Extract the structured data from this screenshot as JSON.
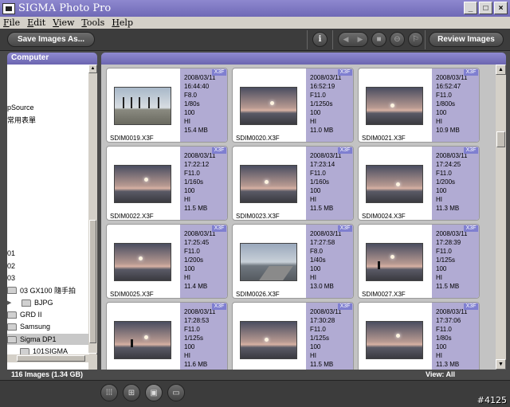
{
  "window": {
    "title": "SIGMA Photo Pro",
    "minimize": "_",
    "maximize": "□",
    "close": "×"
  },
  "menu": [
    "File",
    "Edit",
    "View",
    "Tools",
    "Help"
  ],
  "toolbar": {
    "save_label": "Save Images As...",
    "review_label": "Review Images",
    "info_label": "i"
  },
  "left_panel": {
    "header": "Computer",
    "tree_items": [
      {
        "label": "pSource",
        "type": "text"
      },
      {
        "label": "常用表單",
        "type": "text"
      },
      {
        "label": "01",
        "type": "text"
      },
      {
        "label": "02",
        "type": "text"
      },
      {
        "label": "03",
        "type": "text"
      },
      {
        "label": "03 GX100 隨手拍",
        "type": "folder"
      },
      {
        "label": "BJPG",
        "type": "folder-child"
      },
      {
        "label": "GRD II",
        "type": "folder"
      },
      {
        "label": "Samsung",
        "type": "folder"
      },
      {
        "label": "Sigma DP1",
        "type": "folder"
      },
      {
        "label": "101SIGMA",
        "type": "folder-child"
      }
    ],
    "image_count": "116 Images   (1.34 GB)"
  },
  "right_panel": {
    "view_label": "View: All"
  },
  "badge_label": "X3F",
  "images": [
    {
      "file": "SDIM0019.X3F",
      "date": "2008/03/11",
      "time": "16:44:40",
      "aperture": "F8.0",
      "shutter": "1/80s",
      "iso": "100",
      "quality": "HI",
      "size": "15.4 MB",
      "scene": "palms"
    },
    {
      "file": "SDIM0020.X3F",
      "date": "2008/03/11",
      "time": "16:52:19",
      "aperture": "F11.0",
      "shutter": "1/1250s",
      "iso": "100",
      "quality": "HI",
      "size": "11.0 MB",
      "scene": "sunset"
    },
    {
      "file": "SDIM0021.X3F",
      "date": "2008/03/11",
      "time": "16:52:47",
      "aperture": "F11.0",
      "shutter": "1/800s",
      "iso": "100",
      "quality": "HI",
      "size": "10.9 MB",
      "scene": "sunset"
    },
    {
      "file": "SDIM0022.X3F",
      "date": "2008/03/11",
      "time": "17:22:12",
      "aperture": "F11.0",
      "shutter": "1/160s",
      "iso": "100",
      "quality": "HI",
      "size": "11.5 MB",
      "scene": "sunset"
    },
    {
      "file": "SDIM0023.X3F",
      "date": "2008/03/11",
      "time": "17:23:14",
      "aperture": "F11.0",
      "shutter": "1/160s",
      "iso": "100",
      "quality": "HI",
      "size": "11.5 MB",
      "scene": "sunset"
    },
    {
      "file": "SDIM0024.X3F",
      "date": "2008/03/11",
      "time": "17:24:25",
      "aperture": "F11.0",
      "shutter": "1/200s",
      "iso": "100",
      "quality": "HI",
      "size": "11.3 MB",
      "scene": "sunset"
    },
    {
      "file": "SDIM0025.X3F",
      "date": "2008/03/11",
      "time": "17:25:45",
      "aperture": "F11.0",
      "shutter": "1/200s",
      "iso": "100",
      "quality": "HI",
      "size": "11.4 MB",
      "scene": "sunset"
    },
    {
      "file": "SDIM0026.X3F",
      "date": "2008/03/11",
      "time": "17:27:58",
      "aperture": "F8.0",
      "shutter": "1/40s",
      "iso": "100",
      "quality": "HI",
      "size": "13.0 MB",
      "scene": "pier"
    },
    {
      "file": "SDIM0027.X3F",
      "date": "2008/03/11",
      "time": "17:28:39",
      "aperture": "F11.0",
      "shutter": "1/125s",
      "iso": "100",
      "quality": "HI",
      "size": "11.5 MB",
      "scene": "figure"
    },
    {
      "file": "",
      "date": "2008/03/11",
      "time": "17:28:53",
      "aperture": "F11.0",
      "shutter": "1/125s",
      "iso": "100",
      "quality": "HI",
      "size": "11.6 MB",
      "scene": "figure"
    },
    {
      "file": "",
      "date": "2008/03/11",
      "time": "17:30:28",
      "aperture": "F11.0",
      "shutter": "1/125s",
      "iso": "100",
      "quality": "HI",
      "size": "11.5 MB",
      "scene": "sunset"
    },
    {
      "file": "",
      "date": "2008/03/11",
      "time": "17:37:06",
      "aperture": "F11.0",
      "shutter": "1/80s",
      "iso": "100",
      "quality": "HI",
      "size": "11.3 MB",
      "scene": "sunset"
    }
  ],
  "view_buttons": [
    {
      "name": "small-thumbnails",
      "icon": "grid-small-icon"
    },
    {
      "name": "medium-thumbnails",
      "icon": "grid-medium-icon"
    },
    {
      "name": "single-image",
      "icon": "single-view-icon"
    },
    {
      "name": "details-view",
      "icon": "details-view-icon"
    }
  ],
  "watermark": "#4125",
  "colors": {
    "title_bar": "#7b75c0",
    "meta_panel": "#b1abd3",
    "badge": "#7f7fd0",
    "chrome": "#3c3c3c"
  }
}
